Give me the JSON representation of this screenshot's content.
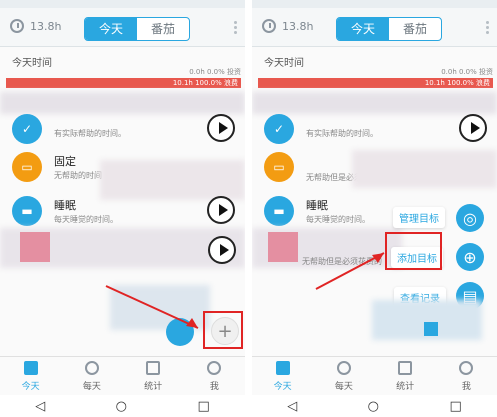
{
  "screens": [
    {
      "header": {
        "hours": "13.8h",
        "tabs": [
          "今天",
          "番茄"
        ]
      },
      "section_title": "今天时间",
      "bar_small": "0.0h 0.0% 投资",
      "bar_red": "10.1h 100.0% 浪费",
      "items": [
        {
          "title": "",
          "desc": "有实际帮助的时间。",
          "color": "#2aa7e0"
        },
        {
          "title": "固定",
          "desc": "无帮助的时间",
          "color": "#f39c12"
        },
        {
          "title": "睡眠",
          "desc": "每天睡觉的时间。",
          "color": "#2aa7e0"
        }
      ]
    },
    {
      "header": {
        "hours": "13.8h",
        "tabs": [
          "今天",
          "番茄"
        ]
      },
      "section_title": "今天时间",
      "bar_small": "0.0h 0.0% 投资",
      "bar_red": "10.1h 100.0% 浪费",
      "items": [
        {
          "title": "",
          "desc": "有实际帮助的时间。",
          "color": "#2aa7e0"
        },
        {
          "title": "",
          "desc": "无帮助但是必须花费的",
          "color": "#f39c12"
        },
        {
          "title": "睡眠",
          "desc": "每天睡觉的时间。",
          "color": "#2aa7e0"
        }
      ],
      "extra_desc": "无帮助但是必须花费的",
      "menu": {
        "manage": "管理目标",
        "add": "添加目标",
        "view": "查看记录"
      }
    }
  ],
  "nav": [
    "今天",
    "每天",
    "统计",
    "我"
  ],
  "sysnav": [
    "◁",
    "○",
    "□"
  ],
  "colors": {
    "accent": "#2aa7e0",
    "waste": "#e8584e",
    "fixed": "#f39c12"
  }
}
